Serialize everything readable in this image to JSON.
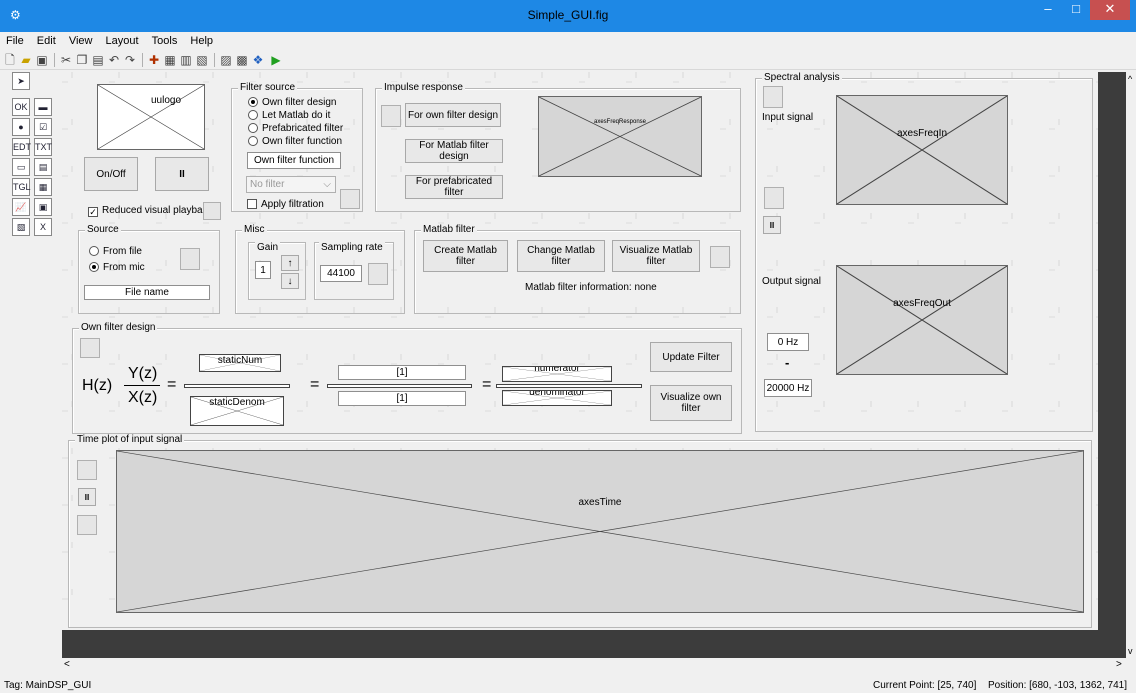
{
  "window": {
    "title": "Simple_GUI.fig",
    "min": "–",
    "max": "□",
    "close": "✕",
    "app_icon": "gear-icon"
  },
  "menu": [
    "File",
    "Edit",
    "View",
    "Layout",
    "Tools",
    "Help"
  ],
  "toolbar": {
    "icons": [
      "new-icon",
      "open-icon",
      "save-icon",
      "cut-icon",
      "copy-icon",
      "paste-icon",
      "undo-icon",
      "redo-icon",
      "align-icon",
      "menu-editor-icon",
      "tab-order-icon",
      "toolbar-editor-icon",
      "editor-icon",
      "property-inspector-icon",
      "object-browser-icon",
      "run-icon"
    ]
  },
  "palette": {
    "items": [
      "select",
      "push-button",
      "slider",
      "radio-button",
      "check-box",
      "edit-text",
      "static-text",
      "popup-menu",
      "listbox",
      "toggle-button",
      "table",
      "axes",
      "panel",
      "button-group",
      "activex"
    ]
  },
  "logo": {
    "label": "uulogo"
  },
  "buttons": {
    "onoff": "On/Off",
    "pause": "II"
  },
  "reduced_visual": "Reduced visual playback",
  "filter_source": {
    "title": "Filter source",
    "options": [
      "Own filter design",
      "Let Matlab do it",
      "Prefabricated filter",
      "Own filter function"
    ],
    "selected": 0,
    "function_edit": "Own filter function",
    "popup": "No filter",
    "apply": "Apply filtration"
  },
  "impulse": {
    "title": "Impulse response",
    "btn_own": "For own filter design",
    "btn_matlab": "For Matlab filter design",
    "btn_prefab": "For prefabricated filter",
    "axes": "axesFreqResponse"
  },
  "spectral": {
    "title": "Spectral analysis",
    "input_signal": "Input signal",
    "axes_in": "axesFreqIn",
    "pause": "II",
    "output_signal": "Output signal",
    "axes_out": "axesFreqOut",
    "freq_low": "0 Hz",
    "dash": "-",
    "freq_high": "20000 Hz"
  },
  "source": {
    "title": "Source",
    "options": [
      "From file",
      "From mic"
    ],
    "selected": 1,
    "file": "File name"
  },
  "misc": {
    "title": "Misc",
    "gain_title": "Gain",
    "gain": "1",
    "up": "↑",
    "down": "↓",
    "rate_title": "Sampling rate",
    "rate": "44100"
  },
  "matlab_filter": {
    "title": "Matlab filter",
    "create": "Create Matlab filter",
    "change": "Change Matlab filter",
    "visualize": "Visualize Matlab filter",
    "info": "Matlab filter information: none"
  },
  "own_filter": {
    "title": "Own filter design",
    "hz": "H(z)",
    "yz": "Y(z)",
    "xz": "X(z)",
    "eq1": "=",
    "eq2": "=",
    "eq3": "=",
    "static_num": "staticNum",
    "static_denom": "staticDenom",
    "num_edit": "[1]",
    "den_edit": "[1]",
    "numerator": "numerator",
    "denominator": "denominator",
    "update": "Update Filter",
    "visualize": "Visualize own filter"
  },
  "time_plot": {
    "title": "Time plot of input signal",
    "pause": "II",
    "axes": "axesTime"
  },
  "status": {
    "tag": "Tag: MainDSP_GUI",
    "current_point": "Current Point:  [25, 740]",
    "position": "Position: [680, -103, 1362, 741]"
  },
  "scroll": {
    "left": "<",
    "right": ">",
    "up": "^",
    "down": "v"
  }
}
